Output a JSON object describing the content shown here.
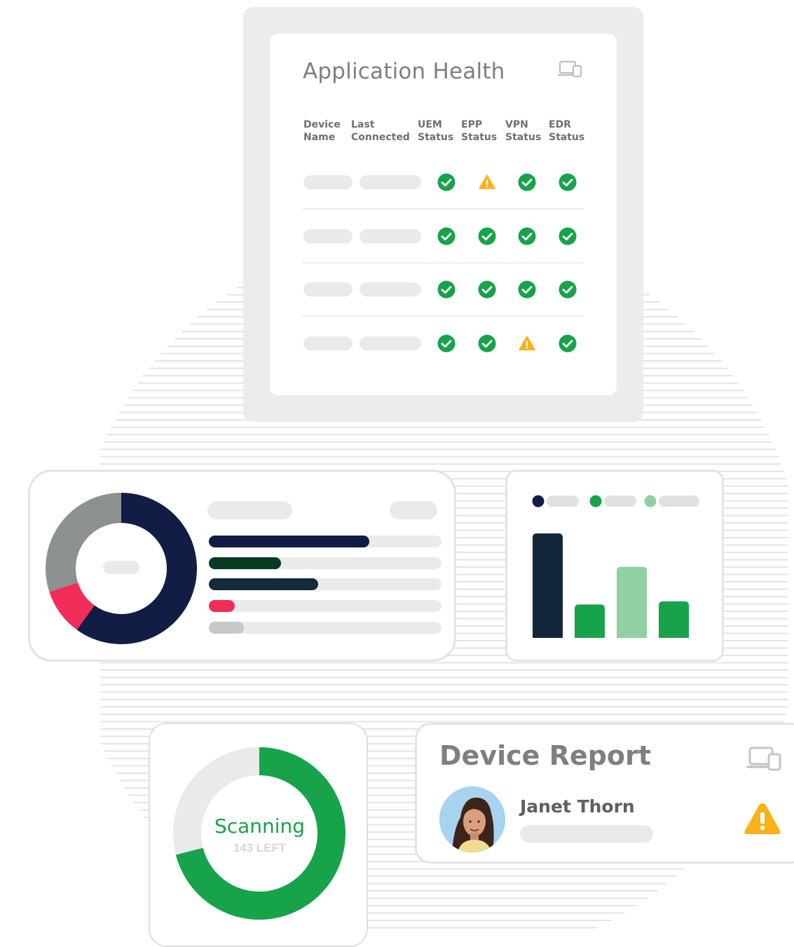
{
  "app_health": {
    "title": "Application Health",
    "icon": "devices-icon",
    "columns": [
      {
        "line1": "Device",
        "line2": "Name"
      },
      {
        "line1": "Last",
        "line2": "Connected"
      },
      {
        "line1": "UEM",
        "line2": "Status"
      },
      {
        "line1": "EPP",
        "line2": "Status"
      },
      {
        "line1": "VPN",
        "line2": "Status"
      },
      {
        "line1": "EDR",
        "line2": "Status"
      }
    ],
    "rows": [
      {
        "uem": "ok",
        "epp": "warning",
        "vpn": "ok",
        "edr": "ok"
      },
      {
        "uem": "ok",
        "epp": "ok",
        "vpn": "ok",
        "edr": "ok"
      },
      {
        "uem": "ok",
        "epp": "ok",
        "vpn": "ok",
        "edr": "ok"
      },
      {
        "uem": "ok",
        "epp": "ok",
        "vpn": "warning",
        "edr": "ok"
      }
    ]
  },
  "donut_widget": {
    "segments": [
      {
        "color": "#121d45",
        "fraction": 0.6
      },
      {
        "color": "#ef2d57",
        "fraction": 0.1
      },
      {
        "color": "#8d9190",
        "fraction": 0.3
      }
    ],
    "bars": [
      {
        "color": "#121d45",
        "fraction": 0.69
      },
      {
        "color": "#053b22",
        "fraction": 0.31
      },
      {
        "color": "#132a3f",
        "fraction": 0.47
      },
      {
        "color": "#ef2d57",
        "fraction": 0.11
      },
      {
        "color": "#c5c8c7",
        "fraction": 0.15
      }
    ]
  },
  "bar_widget": {
    "legend_colors": [
      "#121d45",
      "#17a34a",
      "#8fd1a2"
    ],
    "bars": [
      {
        "color": "#12263b",
        "value": 1.0
      },
      {
        "color": "#17a34a",
        "value": 0.32
      },
      {
        "color": "#8fd1a2",
        "value": 0.68
      },
      {
        "color": "#17a34a",
        "value": 0.35
      }
    ]
  },
  "scan": {
    "label": "Scanning",
    "sublabel": "143 LEFT",
    "progress": 0.71,
    "progress_color": "#17a34a",
    "track_color": "#e9eaea"
  },
  "report": {
    "title": "Device Report",
    "user_name": "Janet Thorn",
    "status": "warning",
    "icon": "devices-icon"
  },
  "colors": {
    "ok": "#17a34a",
    "warning": "#fbb117"
  }
}
